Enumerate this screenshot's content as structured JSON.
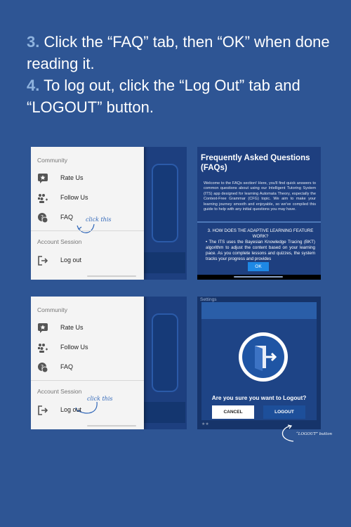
{
  "instructions": {
    "step3_number": "3.",
    "step3_text": " Click the “FAQ” tab, then “OK” when done reading it.",
    "step4_number": "4.",
    "step4_text": " To log out, click the “Log Out” tab and “LOGOUT” button."
  },
  "drawer": {
    "community_label": "Community",
    "rate_us": "Rate Us",
    "follow_us": "Follow Us",
    "faq": "FAQ",
    "account_session_label": "Account Session",
    "log_out": "Log out"
  },
  "annotations": {
    "click_this": "click this",
    "logout_button_note": "“LOGOUT” button"
  },
  "faq": {
    "title": "Frequently Asked Questions (FAQs)",
    "intro": "Welcome to the FAQs section! Here, you'll find quick answers to common questions about using our Intelligent Tutoring System (ITS) app designed for learning Automata Theory, especially the Context-Free Grammar (CFG) topic. We aim to make your learning journey smooth and enjoyable, so we've compiled this guide to help with any initial questions you may have.",
    "question": "3. HOW DOES THE ADAPTIVE LEARNING FEATURE WORK?",
    "answer": "• The ITS uses the Bayesian Knowledge Tracing (BKT) algorithm to adjust the content based on your learning pace. As you complete lessons and quizzes, the system tracks your progress and provides",
    "ok": "OK"
  },
  "logout_dialog": {
    "settings_label": "Settings",
    "question": "Are you sure you want to Logout?",
    "cancel": "CANCEL",
    "logout": "LOGOUT",
    "icon": "logout-door-icon"
  },
  "colors": {
    "background": "#2e5594",
    "accent_number": "#8fb3de",
    "ok_button": "#1e88e5"
  }
}
